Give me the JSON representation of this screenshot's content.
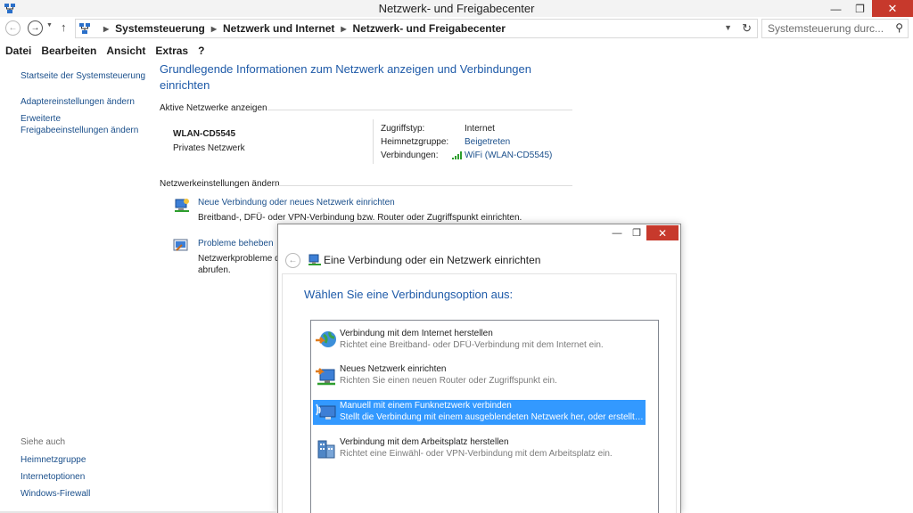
{
  "window": {
    "title": "Netzwerk- und Freigabecenter",
    "minimize": "—",
    "maximize": "❐",
    "close": "✕"
  },
  "address": {
    "crumbs": [
      "Systemsteuerung",
      "Netzwerk und Internet",
      "Netzwerk- und Freigabecenter"
    ],
    "search_placeholder": "Systemsteuerung durc..."
  },
  "menu": [
    "Datei",
    "Bearbeiten",
    "Ansicht",
    "Extras",
    "?"
  ],
  "sidebar": {
    "home_link": "Startseite der Systemsteuerung",
    "links": [
      "Adaptereinstellungen ändern",
      "Erweiterte Freigabeeinstellungen ändern"
    ],
    "see_also_title": "Siehe auch",
    "see_also": [
      "Heimnetzgruppe",
      "Internetoptionen",
      "Windows-Firewall"
    ]
  },
  "main": {
    "title": "Grundlegende Informationen zum Netzwerk anzeigen und Verbindungen einrichten",
    "active_networks_header": "Aktive Netzwerke anzeigen",
    "network": {
      "name": "WLAN-CD5545",
      "type": "Privates Netzwerk",
      "access_type_label": "Zugriffstyp:",
      "access_type_value": "Internet",
      "homegroup_label": "Heimnetzgruppe:",
      "homegroup_value": "Beigetreten",
      "connections_label": "Verbindungen:",
      "connections_value": "WiFi (WLAN-CD5545)"
    },
    "change_settings_header": "Netzwerkeinstellungen ändern",
    "tasks": [
      {
        "link": "Neue Verbindung oder neues Netzwerk einrichten",
        "desc": "Breitband-, DFÜ- oder VPN-Verbindung bzw. Router oder Zugriffspunkt einrichten."
      },
      {
        "link": "Probleme beheben",
        "desc_line1": "Netzwerkprobleme d",
        "desc_line2": "abrufen."
      }
    ]
  },
  "dialog": {
    "title": "Eine Verbindung oder ein Netzwerk einrichten",
    "heading": "Wählen Sie eine Verbindungsoption aus:",
    "options": [
      {
        "title": "Verbindung mit dem Internet herstellen",
        "desc": "Richtet eine Breitband- oder DFÜ-Verbindung mit dem Internet ein.",
        "selected": false
      },
      {
        "title": "Neues Netzwerk einrichten",
        "desc": "Richten Sie einen neuen Router oder Zugriffspunkt ein.",
        "selected": false
      },
      {
        "title": "Manuell mit einem Funknetzwerk verbinden",
        "desc": "Stellt die Verbindung mit einem ausgeblendeten Netzwerk her, oder erstellt ein...",
        "selected": true
      },
      {
        "title": "Verbindung mit dem Arbeitsplatz herstellen",
        "desc": "Richtet eine Einwähl- oder VPN-Verbindung mit dem Arbeitsplatz ein.",
        "selected": false
      }
    ]
  },
  "colors": {
    "link": "#1a4f8b",
    "heading": "#1e5aa8",
    "selection": "#3399ff",
    "close_button": "#c7392c"
  }
}
